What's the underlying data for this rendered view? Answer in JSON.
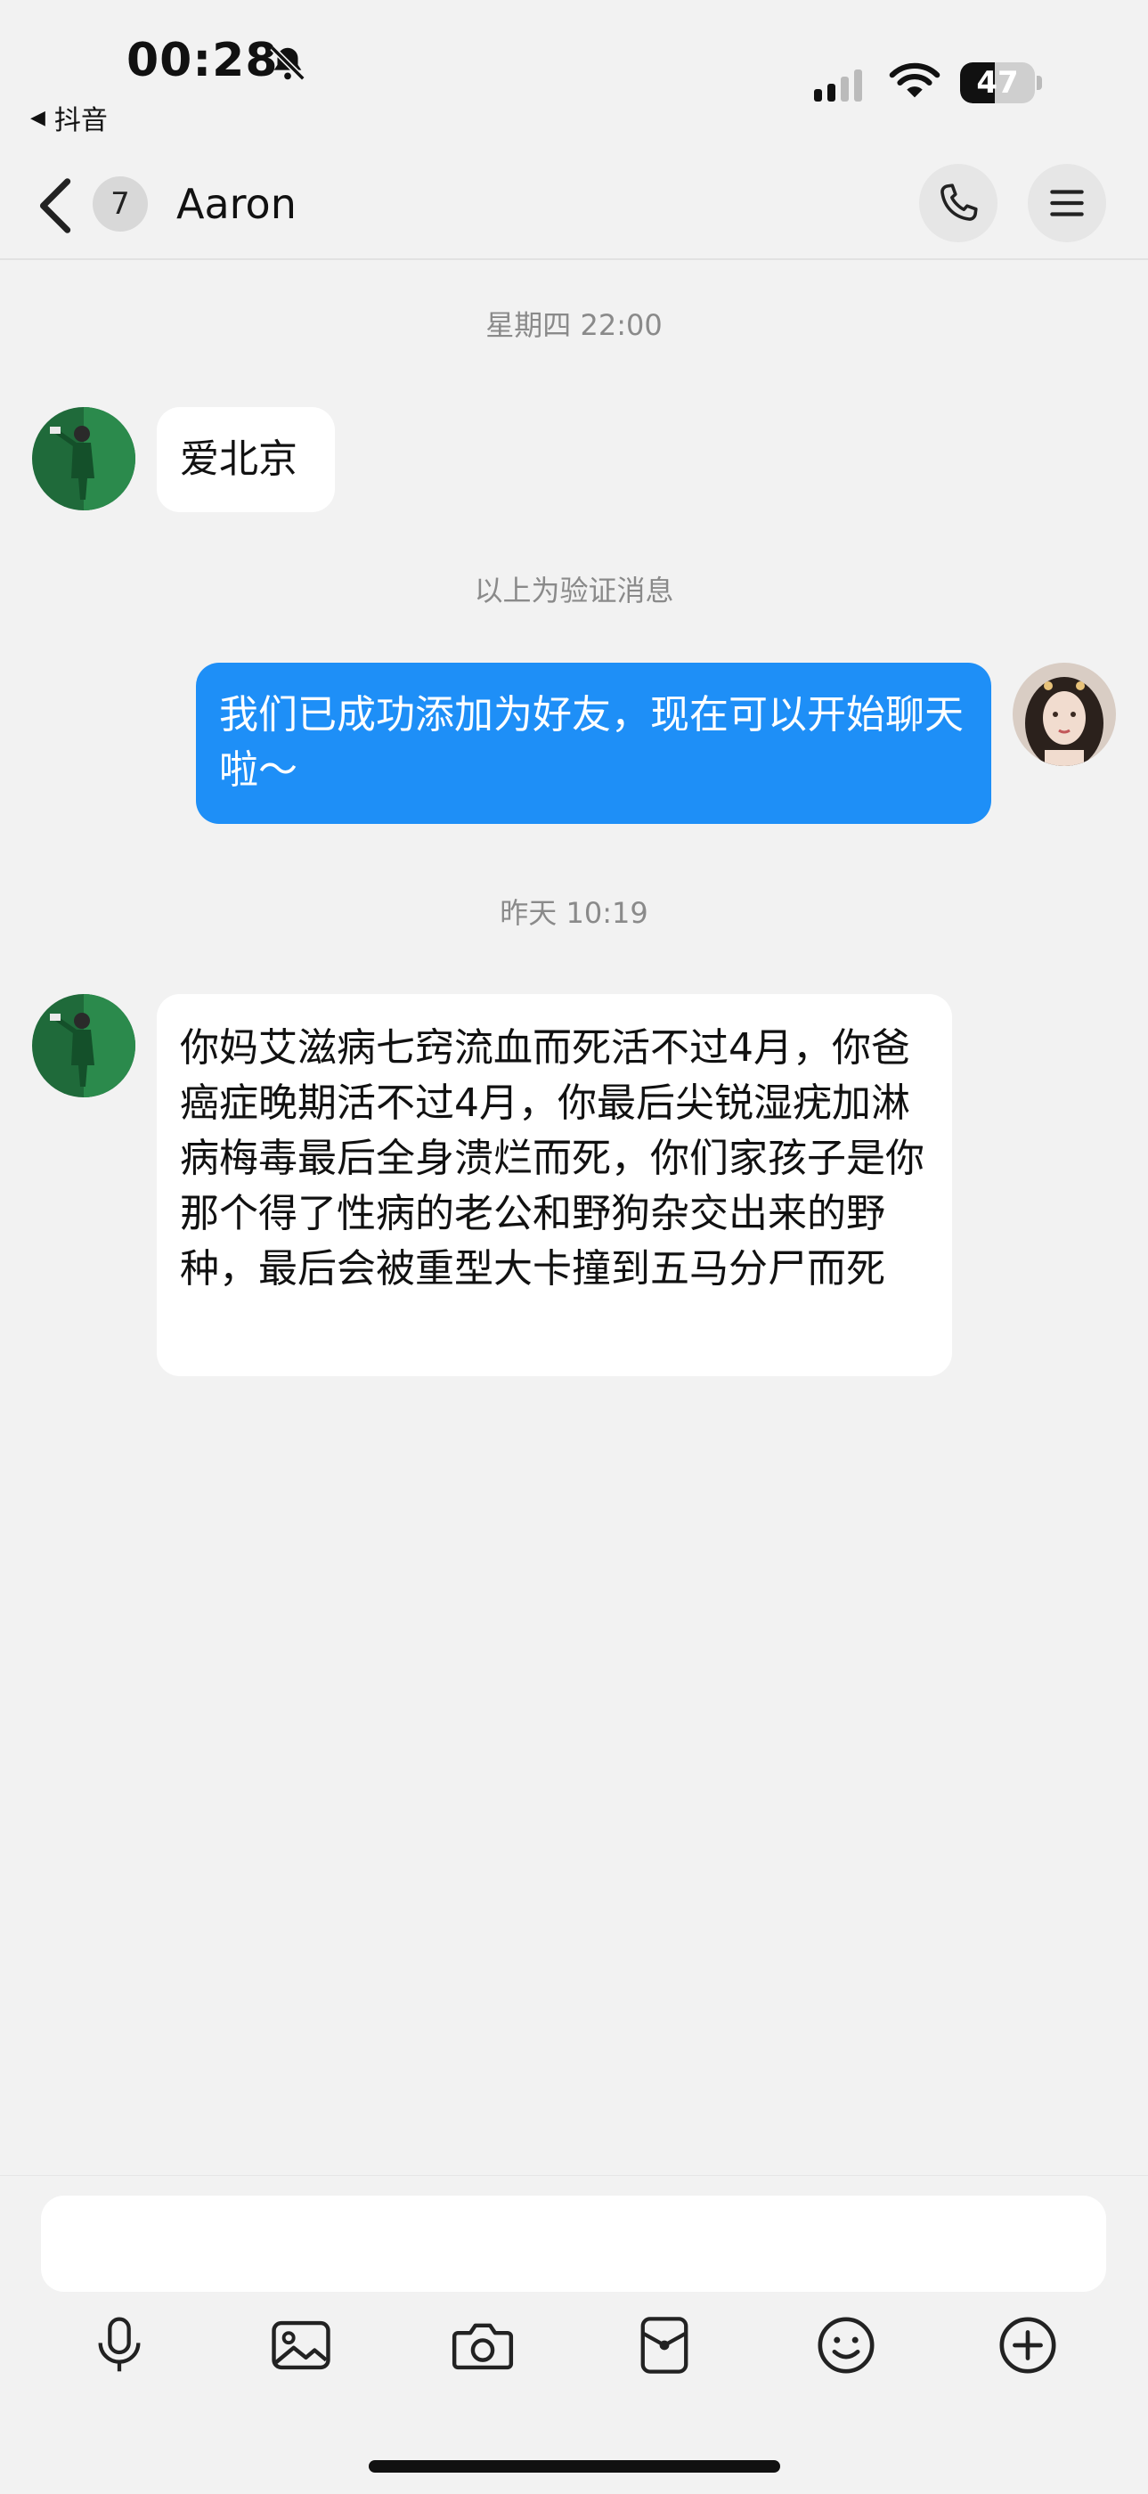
{
  "status_bar": {
    "time": "00:28",
    "back_app_label": "抖音",
    "battery_level": 47,
    "battery_text": "47"
  },
  "header": {
    "unread_count": "7",
    "contact_name": "Aaron"
  },
  "messages": [
    {
      "kind": "timestamp",
      "text": "星期四 22:00"
    },
    {
      "kind": "incoming",
      "text": "爱北京"
    },
    {
      "kind": "notice",
      "text": "以上为验证消息"
    },
    {
      "kind": "outgoing",
      "text": "我们已成功添加为好友，现在可以开始聊天啦～"
    },
    {
      "kind": "timestamp",
      "text": "昨天 10:19"
    },
    {
      "kind": "incoming",
      "text": "你妈艾滋病七窍流血而死活不过4月，你爸癌症晚期活不过4月，你最后尖锐湿疣加淋病梅毒最后全身溃烂而死，你们家孩子是你那个得了性病的老公和野狗杂交出来的野种，最后会被重型大卡撞到五马分尸而死"
    }
  ],
  "input": {
    "value": "",
    "placeholder": ""
  },
  "toolbar": [
    "microphone-icon",
    "image-icon",
    "camera-icon",
    "sticker-icon",
    "emoji-icon",
    "plus-icon"
  ],
  "colors": {
    "background": "#f2f2f2",
    "outgoing_bubble": "#1e8ff7",
    "incoming_bubble": "#ffffff",
    "meta_text": "#8a8a8a"
  }
}
